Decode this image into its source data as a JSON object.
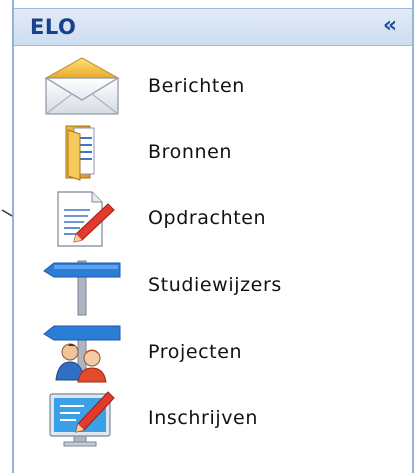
{
  "panel": {
    "title": "ELO",
    "collapse_glyph": "«"
  },
  "items": [
    {
      "label": "Berichten",
      "icon": "envelope-icon"
    },
    {
      "label": "Bronnen",
      "icon": "folder-icon"
    },
    {
      "label": "Opdrachten",
      "icon": "document-pencil-icon"
    },
    {
      "label": "Studiewijzers",
      "icon": "signpost-icon"
    },
    {
      "label": "Projecten",
      "icon": "people-signpost-icon"
    },
    {
      "label": "Inschrijven",
      "icon": "monitor-pencil-icon"
    }
  ],
  "colors": {
    "header_text": "#15428b",
    "border": "#98b3da",
    "header_bg": "#dbe6f5"
  }
}
